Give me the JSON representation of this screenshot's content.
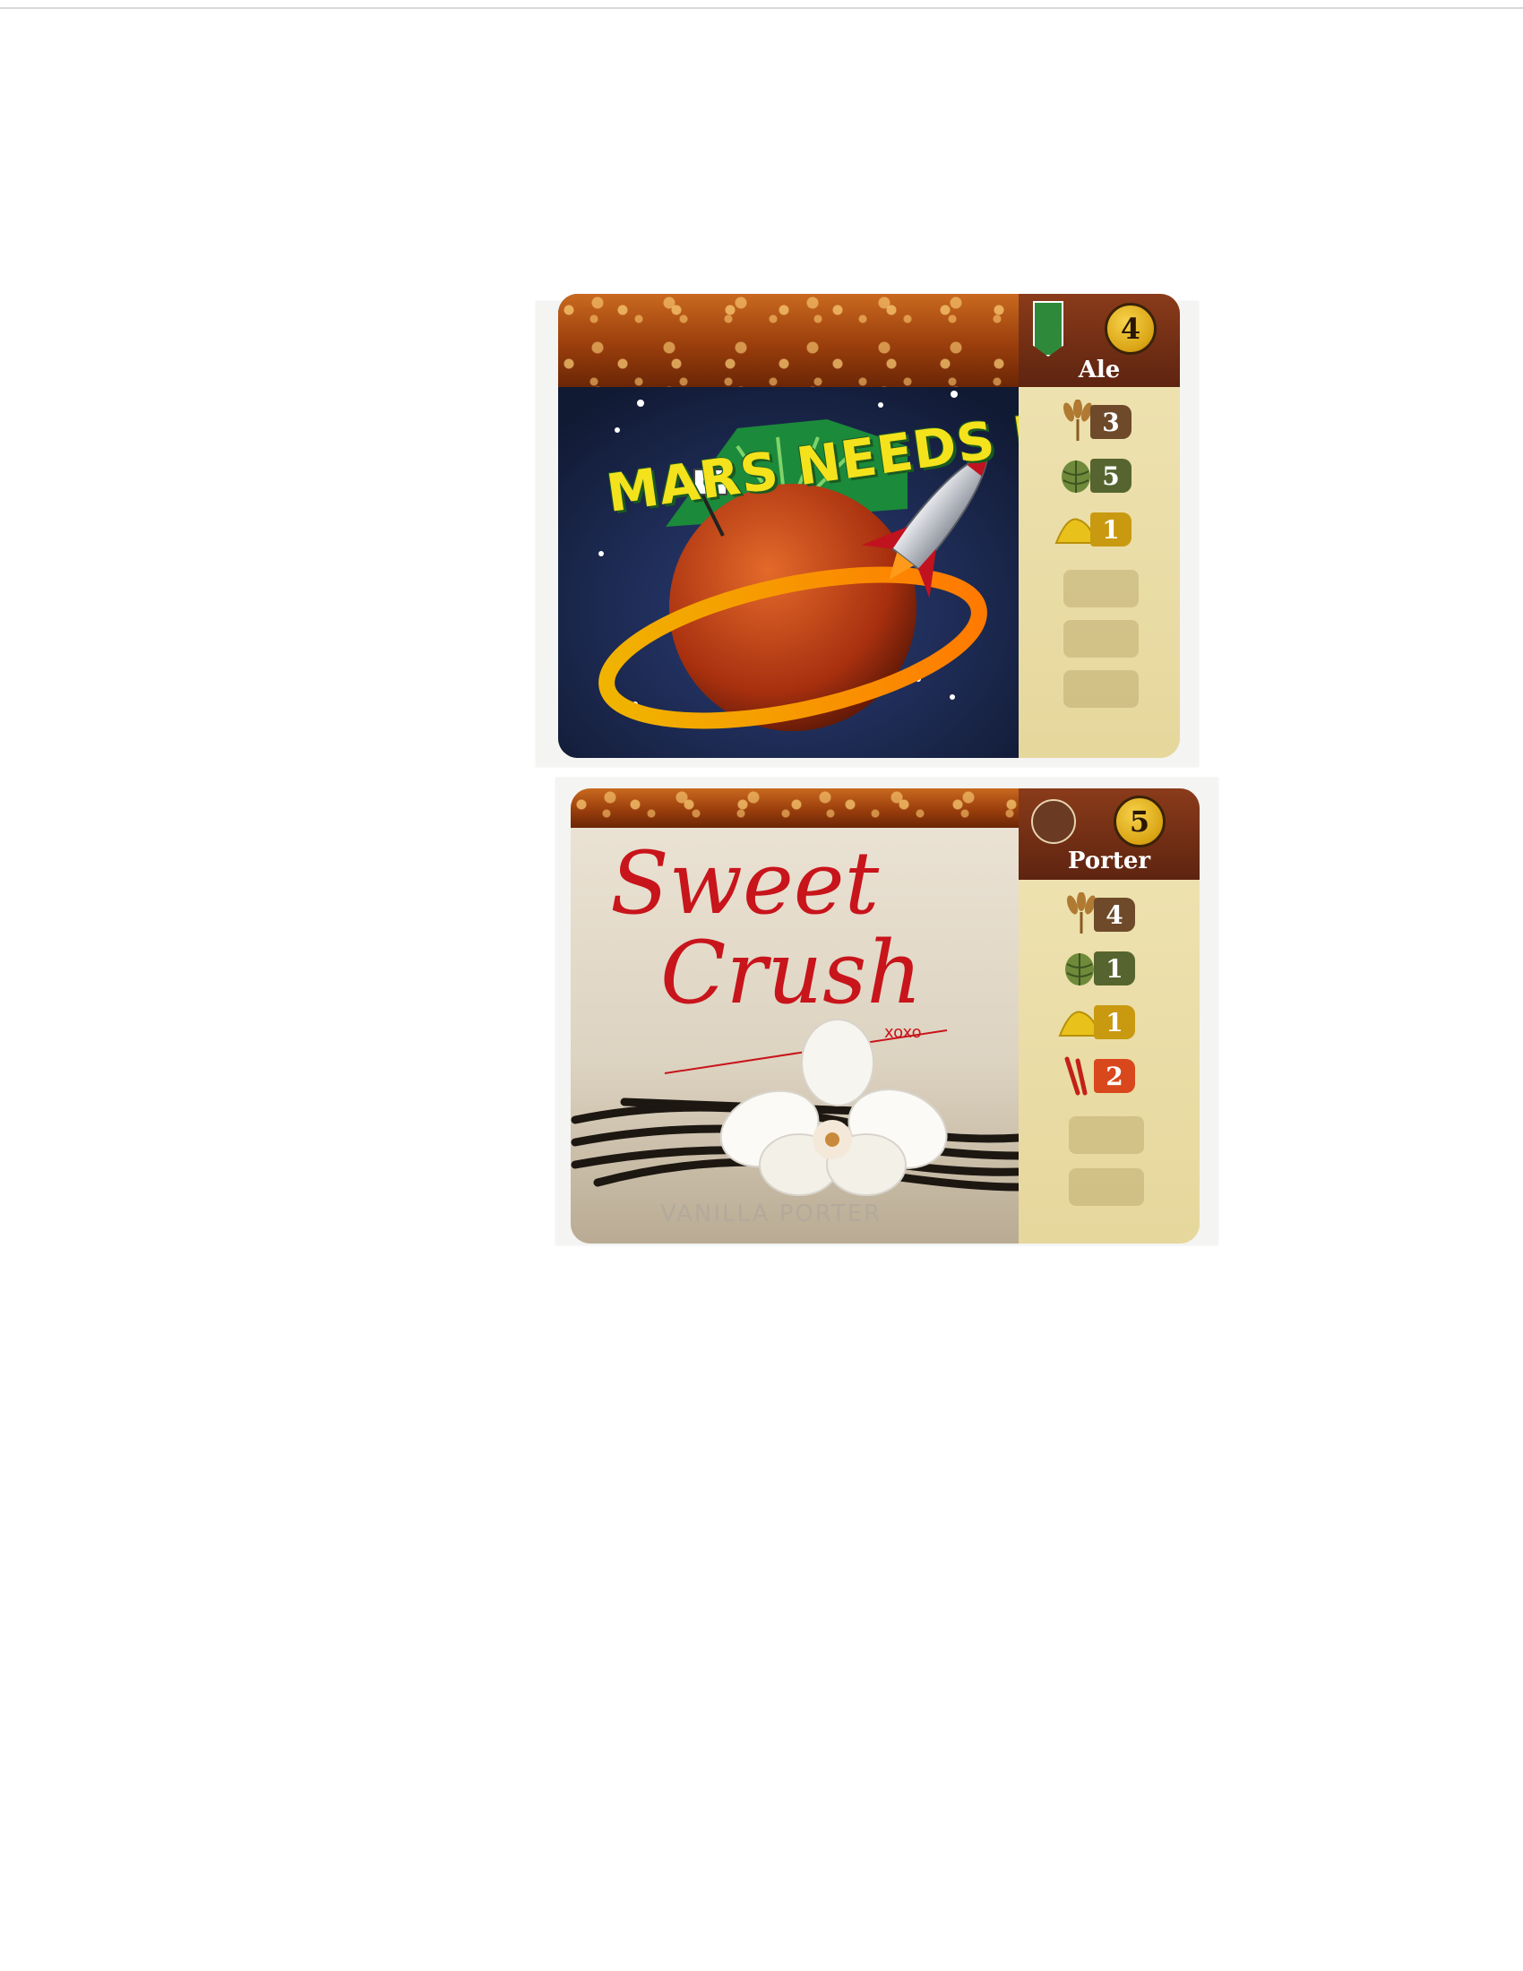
{
  "cards": [
    {
      "title": "MARS NEEDS IPA",
      "style": "Ale",
      "points": "4",
      "ingredients": [
        {
          "type": "malt",
          "icon": "wheat-icon",
          "value": "3"
        },
        {
          "type": "hops",
          "icon": "hop-icon",
          "value": "5"
        },
        {
          "type": "yeast",
          "icon": "yeast-icon",
          "value": "1"
        }
      ],
      "empty_slots": 3,
      "colors": {
        "title": "#f4e21c",
        "banner": "#1b8a3a",
        "sky": "#16243f"
      }
    },
    {
      "title_line1": "Sweet",
      "title_line2": "Crush",
      "signoff": "xoxo",
      "subtitle": "VANILLA PORTER",
      "style": "Porter",
      "points": "5",
      "ingredients": [
        {
          "type": "malt",
          "icon": "wheat-icon",
          "value": "4"
        },
        {
          "type": "hops",
          "icon": "hop-icon",
          "value": "1"
        },
        {
          "type": "yeast",
          "icon": "yeast-icon",
          "value": "1"
        },
        {
          "type": "spice",
          "icon": "vanilla-pod-icon",
          "value": "2"
        }
      ],
      "empty_slots": 2,
      "colors": {
        "title": "#c8141b",
        "paper": "#ece4d6"
      }
    }
  ]
}
